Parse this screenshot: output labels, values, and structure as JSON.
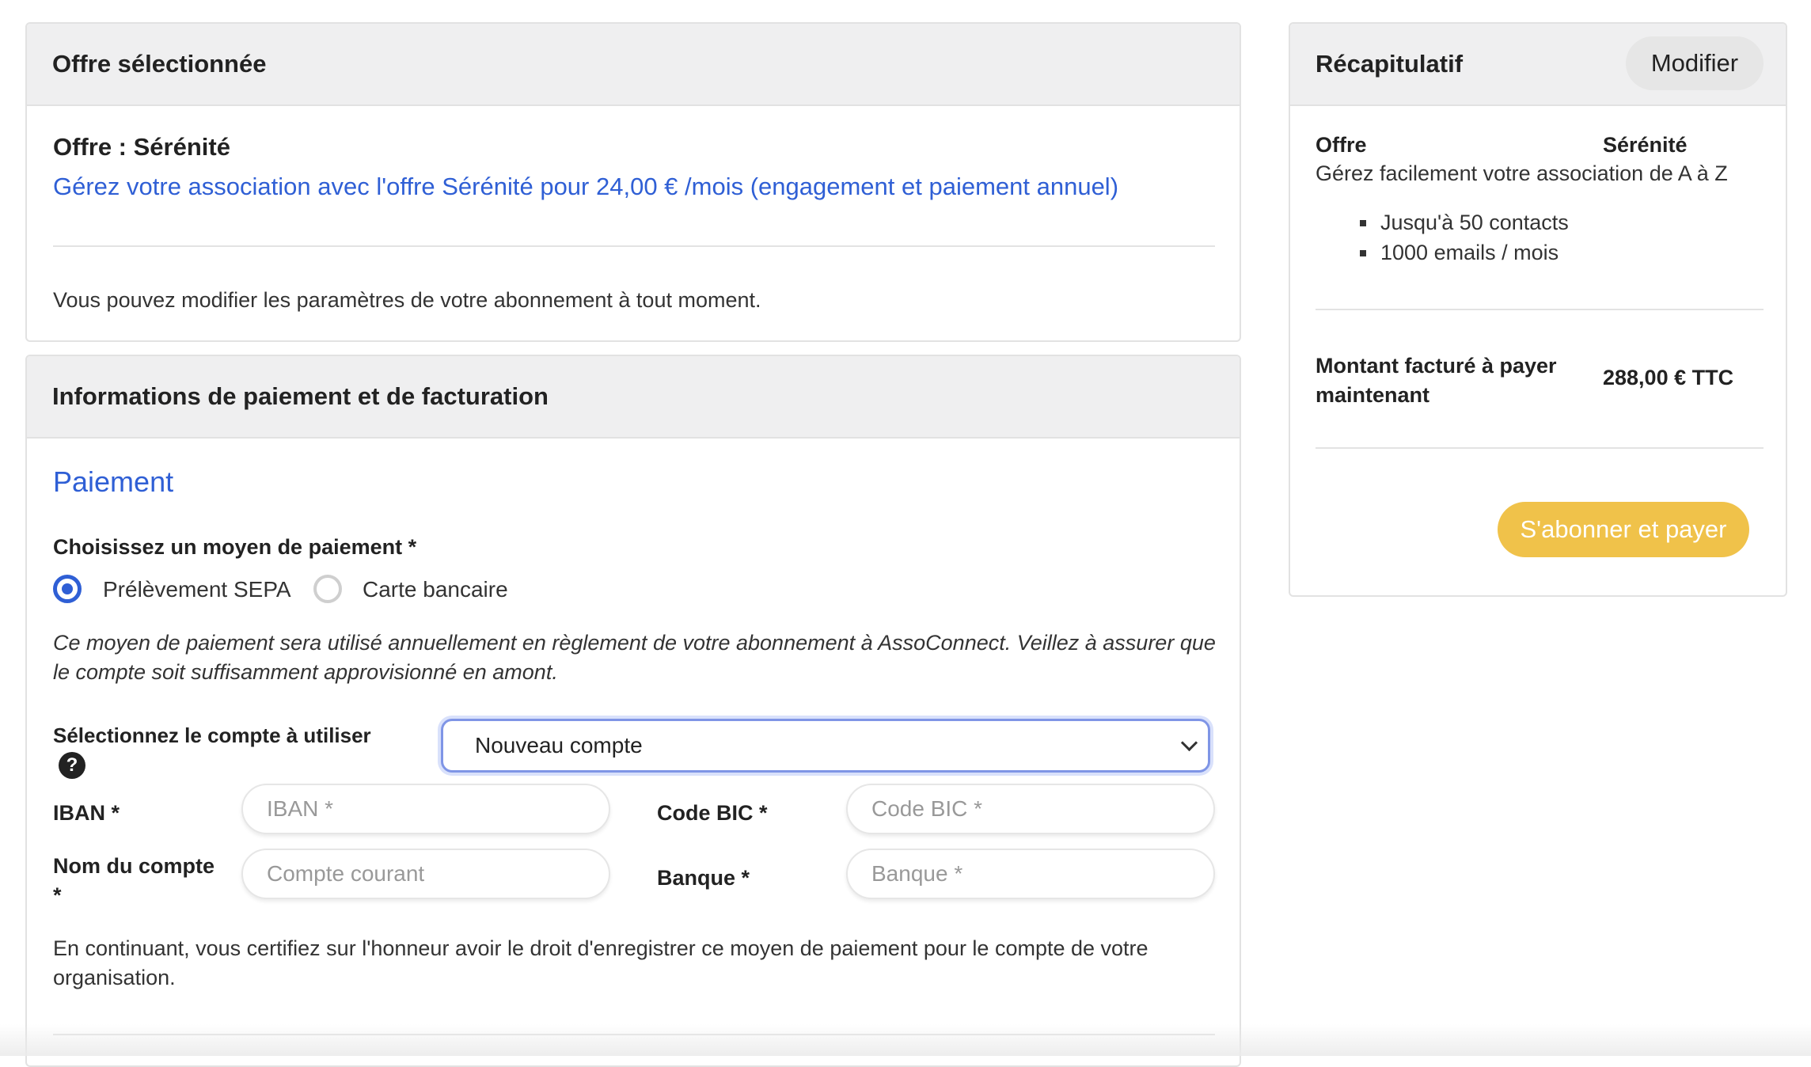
{
  "offer_card": {
    "title": "Offre sélectionnée",
    "offer_name": "Offre : Sérénité",
    "offer_description": "Gérez votre association avec l'offre Sérénité pour 24,00 € /mois (engagement et paiement annuel)",
    "note": "Vous pouvez modifier les paramètres de votre abonnement à tout moment."
  },
  "payment_card": {
    "title": "Informations de paiement et de facturation",
    "section_title": "Paiement",
    "method_label": "Choisissez un moyen de paiement *",
    "methods": [
      {
        "label": "Prélèvement SEPA",
        "selected": true
      },
      {
        "label": "Carte bancaire",
        "selected": false
      }
    ],
    "method_note": "Ce moyen de paiement sera utilisé annuellement en règlement de votre abonnement à AssoConnect. Veillez à assurer que le compte soit suffisamment approvisionné en amont.",
    "account_label": "Sélectionnez le compte à utiliser",
    "account_value": "Nouveau compte",
    "iban_label": "IBAN *",
    "iban_placeholder": "IBAN *",
    "bic_label": "Code BIC *",
    "bic_placeholder": "Code BIC *",
    "account_name_label": "Nom du compte *",
    "account_name_placeholder": "Compte courant",
    "bank_label": "Banque *",
    "bank_placeholder": "Banque *",
    "consent_text": "En continuant, vous certifiez sur l'honneur avoir le droit d'enregistrer ce moyen de paiement pour le compte de votre organisation."
  },
  "summary_card": {
    "title": "Récapitulatif",
    "modify_label": "Modifier",
    "offer_label": "Offre",
    "offer_value": "Sérénité",
    "offer_tagline": "Gérez facilement votre association de A à Z",
    "features": [
      "Jusqu'à 50 contacts",
      "1000 emails / mois"
    ],
    "amount_label": "Montant facturé à payer maintenant",
    "amount_value": "288,00 € TTC",
    "pay_button_label": "S'abonner et payer"
  },
  "colors": {
    "accent_blue": "#2f5fd5",
    "pay_button": "#f0c24a",
    "header_bg": "#efeff0"
  }
}
